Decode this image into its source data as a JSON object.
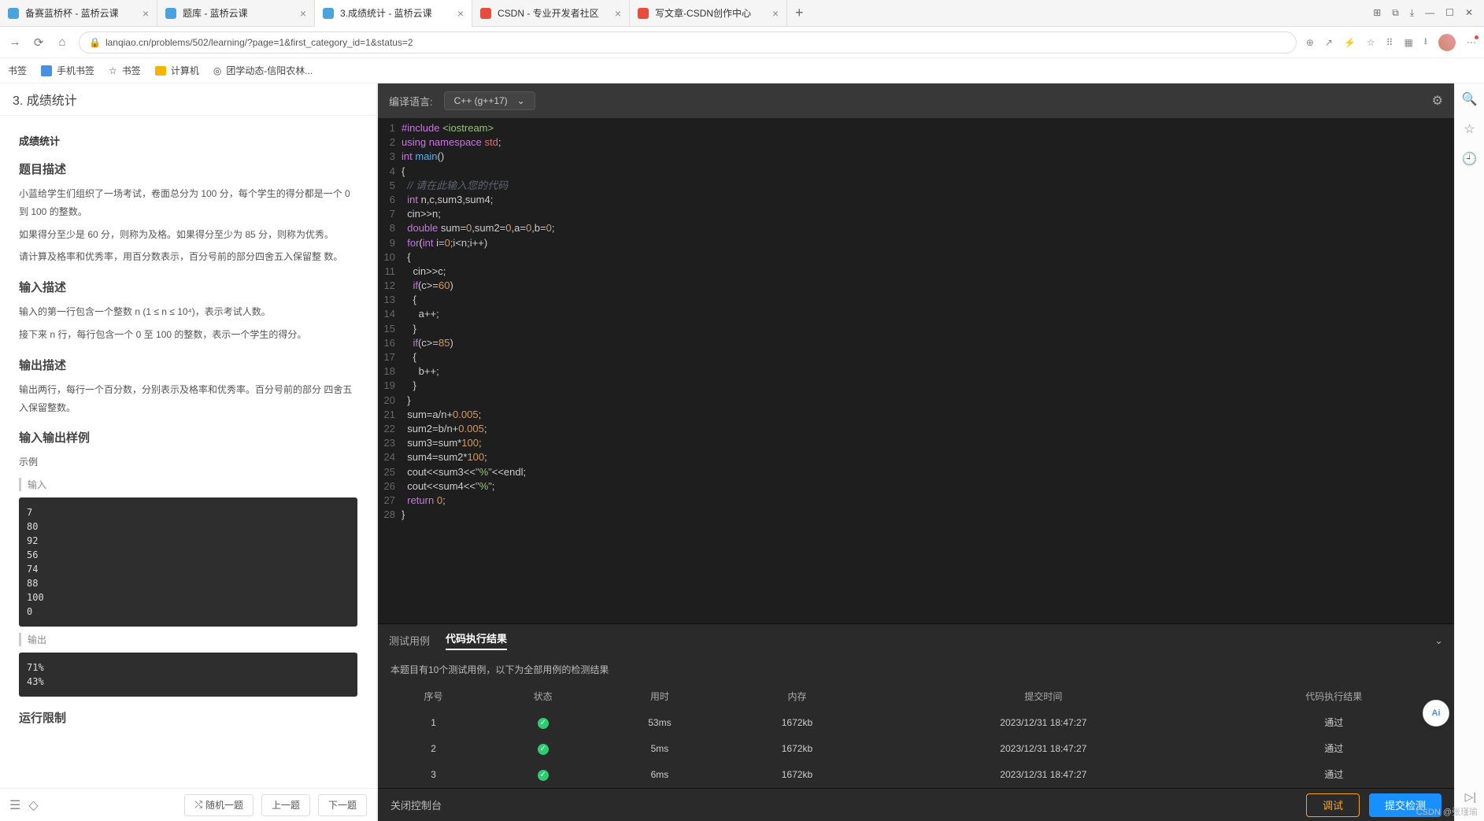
{
  "tabs": [
    {
      "title": "备赛蓝桥杯 - 蓝桥云课",
      "favcolor": "#4aa3df"
    },
    {
      "title": "题库 - 蓝桥云课",
      "favcolor": "#4aa3df"
    },
    {
      "title": "3.成绩统计 - 蓝桥云课",
      "favcolor": "#4aa3df",
      "active": true
    },
    {
      "title": "CSDN - 专业开发者社区",
      "favcolor": "#e74c3c"
    },
    {
      "title": "写文章-CSDN创作中心",
      "favcolor": "#e74c3c"
    }
  ],
  "url": "lanqiao.cn/problems/502/learning/?page=1&first_category_id=1&status=2",
  "bookmarks": {
    "b1": "书签",
    "b2": "手机书签",
    "b3": "书签",
    "b4": "计算机",
    "b5": "团学动态-信阳农林..."
  },
  "problem": {
    "header": "3. 成绩统计",
    "title_small": "成绩统计",
    "s1": "题目描述",
    "p1": "小蓝给学生们组织了一场考试，卷面总分为 100 分，每个学生的得分都是一个 0 到 100 的整数。",
    "p2": "如果得分至少是 60 分，则称为及格。如果得分至少为 85 分，则称为优秀。",
    "p3": "请计算及格率和优秀率，用百分数表示，百分号前的部分四舍五入保留整 数。",
    "s2": "输入描述",
    "p4": "输入的第一行包含一个整数 n (1 ≤ n ≤ 10⁴)，表示考试人数。",
    "p5": "接下来 n 行，每行包含一个 0 至 100 的整数，表示一个学生的得分。",
    "s3": "输出描述",
    "p6": "输出两行，每行一个百分数，分别表示及格率和优秀率。百分号前的部分 四舍五入保留整数。",
    "s4": "输入输出样例",
    "sample_label": "示例",
    "in_label": "输入",
    "out_label": "输出",
    "sample_in": "7\n80\n92\n56\n74\n88\n100\n0",
    "sample_out": "71%\n43%",
    "s5": "运行限制"
  },
  "footer": {
    "shuffle": "随机一题",
    "prev": "上一题",
    "next": "下一题"
  },
  "editor": {
    "lang_label": "编译语言:",
    "lang_value": "C++ (g++17)",
    "code": [
      {
        "n": "1",
        "h": "<span class='k-pre'>#include</span> <span class='k-str'>&lt;iostream&gt;</span>"
      },
      {
        "n": "2",
        "h": "<span class='k-pre'>using</span> <span class='k-pre'>namespace</span> <span class='k-id'>std</span>;"
      },
      {
        "n": "3",
        "h": "<span class='k-type'>int</span> <span class='k-fn'>main</span>()"
      },
      {
        "n": "4",
        "h": "{"
      },
      {
        "n": "5",
        "h": "  <span class='k-cm'>// 请在此输入您的代码</span>"
      },
      {
        "n": "6",
        "h": "  <span class='k-type'>int</span> n,c,sum3,sum4;"
      },
      {
        "n": "7",
        "h": "  cin&gt;&gt;n;"
      },
      {
        "n": "8",
        "h": "  <span class='k-type'>double</span> sum=<span class='k-num'>0</span>,sum2=<span class='k-num'>0</span>,a=<span class='k-num'>0</span>,b=<span class='k-num'>0</span>;"
      },
      {
        "n": "9",
        "h": "  <span class='k-pre'>for</span>(<span class='k-type'>int</span> i=<span class='k-num'>0</span>;i&lt;n;i++)"
      },
      {
        "n": "10",
        "h": "  {"
      },
      {
        "n": "11",
        "h": "    cin&gt;&gt;c;"
      },
      {
        "n": "12",
        "h": "    <span class='k-pre'>if</span>(c&gt;=<span class='k-num'>60</span>)"
      },
      {
        "n": "13",
        "h": "    {"
      },
      {
        "n": "14",
        "h": "      a++;"
      },
      {
        "n": "15",
        "h": "    }"
      },
      {
        "n": "16",
        "h": "    <span class='k-pre'>if</span>(c&gt;=<span class='k-num'>85</span>)"
      },
      {
        "n": "17",
        "h": "    {"
      },
      {
        "n": "18",
        "h": "      b++;"
      },
      {
        "n": "19",
        "h": "    }"
      },
      {
        "n": "20",
        "h": "  }"
      },
      {
        "n": "21",
        "h": "  sum=a/n+<span class='k-num'>0.005</span>;"
      },
      {
        "n": "22",
        "h": "  sum2=b/n+<span class='k-num'>0.005</span>;"
      },
      {
        "n": "23",
        "h": "  sum3=sum*<span class='k-num'>100</span>;"
      },
      {
        "n": "24",
        "h": "  sum4=sum2*<span class='k-num'>100</span>;"
      },
      {
        "n": "25",
        "h": "  cout&lt;&lt;sum3&lt;&lt;<span class='k-str'>\"%\"</span>&lt;&lt;endl;"
      },
      {
        "n": "26",
        "h": "  cout&lt;&lt;sum4&lt;&lt;<span class='k-str'>\"%\"</span>;"
      },
      {
        "n": "27",
        "h": "  <span class='k-pre'>return</span> <span class='k-num'>0</span>;"
      },
      {
        "n": "28",
        "h": "}"
      }
    ]
  },
  "console": {
    "tab1": "测试用例",
    "tab2": "代码执行结果",
    "info": "本题目有10个测试用例，以下为全部用例的检测结果",
    "headers": {
      "c1": "序号",
      "c2": "状态",
      "c3": "用时",
      "c4": "内存",
      "c5": "提交时间",
      "c6": "代码执行结果"
    },
    "rows": [
      {
        "id": "1",
        "time": "53ms",
        "mem": "1672kb",
        "at": "2023/12/31 18:47:27",
        "res": "通过"
      },
      {
        "id": "2",
        "time": "5ms",
        "mem": "1672kb",
        "at": "2023/12/31 18:47:27",
        "res": "通过"
      },
      {
        "id": "3",
        "time": "6ms",
        "mem": "1672kb",
        "at": "2023/12/31 18:47:27",
        "res": "通过"
      }
    ],
    "close": "关闭控制台",
    "debug": "调试",
    "submit": "提交检测"
  },
  "watermark": "CSDN @张瑾瑜",
  "ai": "Ai"
}
